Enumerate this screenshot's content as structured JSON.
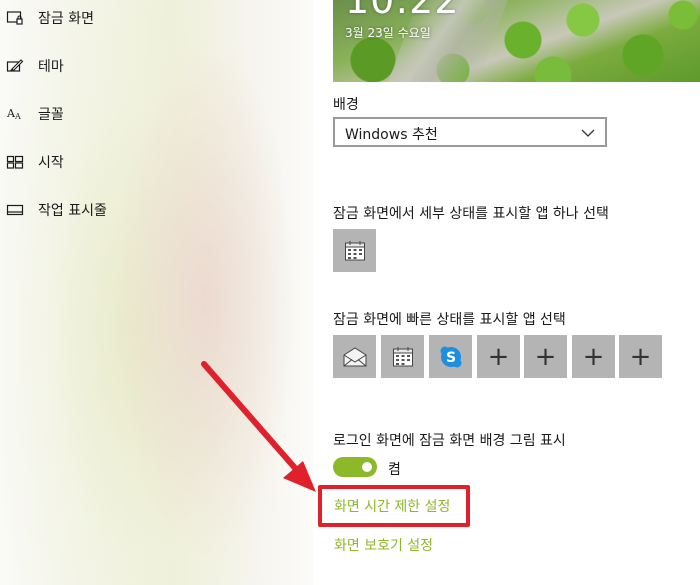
{
  "sidebar": {
    "items": [
      {
        "label": "잠금 화면",
        "icon": "lock-screen-icon"
      },
      {
        "label": "테마",
        "icon": "theme-brush-icon"
      },
      {
        "label": "글꼴",
        "icon": "font-icon"
      },
      {
        "label": "시작",
        "icon": "start-grid-icon"
      },
      {
        "label": "작업 표시줄",
        "icon": "taskbar-icon"
      }
    ]
  },
  "preview": {
    "time": "10:22",
    "date": "3월 23일 수요일"
  },
  "background": {
    "heading": "배경",
    "dropdown_value": "Windows 추천"
  },
  "detailed_status": {
    "heading": "잠금 화면에서 세부 상태를 표시할 앱 하나 선택",
    "apps": [
      {
        "icon": "calendar-icon"
      }
    ]
  },
  "quick_status": {
    "heading": "잠금 화면에 빠른 상태를 표시할 앱 선택",
    "apps": [
      {
        "icon": "mail-icon"
      },
      {
        "icon": "calendar-icon"
      },
      {
        "icon": "skype-icon"
      },
      {
        "icon": "plus-icon",
        "text": "+"
      },
      {
        "icon": "plus-icon",
        "text": "+"
      },
      {
        "icon": "plus-icon",
        "text": "+"
      },
      {
        "icon": "plus-icon",
        "text": "+"
      }
    ]
  },
  "signin_background": {
    "heading": "로그인 화면에 잠금 화면 배경 그림 표시",
    "toggle_label": "켬",
    "toggle_on": true
  },
  "links": {
    "screen_timeout": "화면 시간 제한 설정",
    "screen_saver": "화면 보호기 설정"
  },
  "colors": {
    "accent": "#8fb62d",
    "toggle_on": "#8cb92a",
    "annotation_red": "#e0202a",
    "tile_gray": "#b4b4b4"
  }
}
